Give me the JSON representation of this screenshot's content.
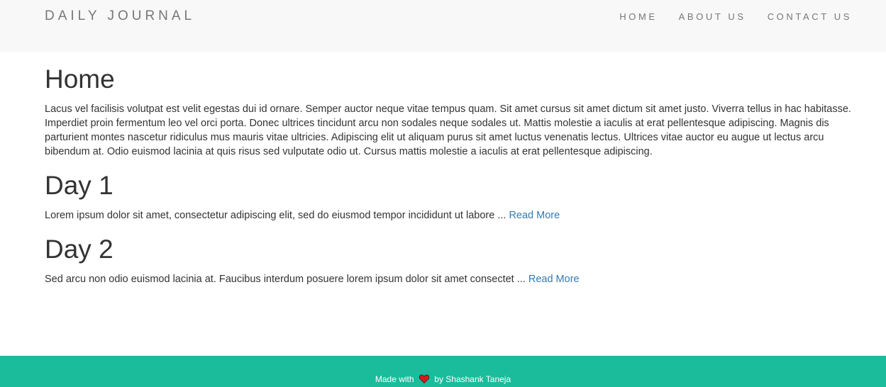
{
  "navbar": {
    "brand": "DAILY JOURNAL",
    "links": [
      "HOME",
      "ABOUT US",
      "CONTACT US"
    ]
  },
  "home": {
    "title": "Home",
    "text": "Lacus vel facilisis volutpat est velit egestas dui id ornare. Semper auctor neque vitae tempus quam. Sit amet cursus sit amet dictum sit amet justo. Viverra tellus in hac habitasse. Imperdiet proin fermentum leo vel orci porta. Donec ultrices tincidunt arcu non sodales neque sodales ut. Mattis molestie a iaculis at erat pellentesque adipiscing. Magnis dis parturient montes nascetur ridiculus mus mauris vitae ultricies. Adipiscing elit ut aliquam purus sit amet luctus venenatis lectus. Ultrices vitae auctor eu augue ut lectus arcu bibendum at. Odio euismod lacinia at quis risus sed vulputate odio ut. Cursus mattis molestie a iaculis at erat pellentesque adipiscing."
  },
  "posts": [
    {
      "title": "Day 1",
      "excerpt": "Lorem ipsum dolor sit amet, consectetur adipiscing elit, sed do eiusmod tempor incididunt ut labore ... ",
      "read_more": "Read More"
    },
    {
      "title": "Day 2",
      "excerpt": "Sed arcu non odio euismod lacinia at. Faucibus interdum posuere lorem ipsum dolor sit amet consectet ... ",
      "read_more": "Read More"
    }
  ],
  "footer": {
    "prefix": "Made with",
    "icon": "heart-icon",
    "suffix": "by Shashank Taneja"
  },
  "colors": {
    "navbar_bg": "#f8f8f8",
    "footer_bg": "#1abc9c",
    "link": "#337ab7",
    "heart": "#e0161e"
  }
}
